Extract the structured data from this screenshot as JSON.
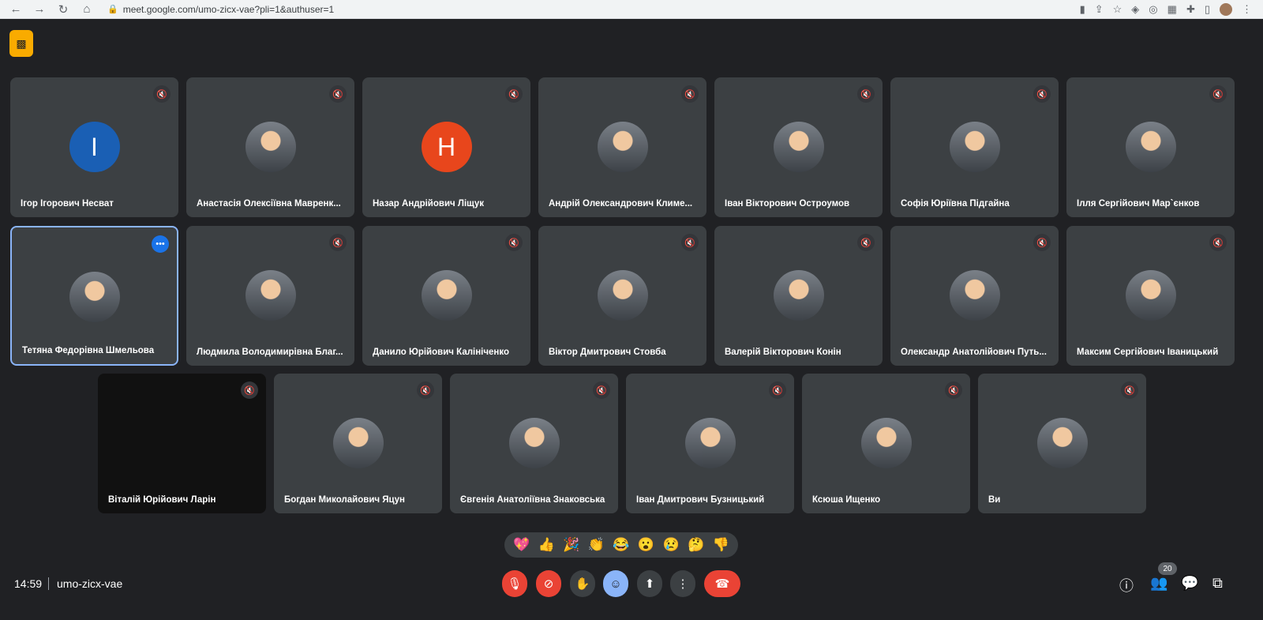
{
  "browser": {
    "url": "meet.google.com/umo-zicx-vae?pli=1&authuser=1",
    "nav_icons": [
      "back-icon",
      "forward-icon",
      "reload-icon",
      "home-icon"
    ]
  },
  "tiles": [
    {
      "name": "Ігор Ігорович Несват",
      "letter": "І",
      "color": "#1a5fb4"
    },
    {
      "name": "Анастасія Олексіївна Мавренк..."
    },
    {
      "name": "Назар Андрійович Ліщук",
      "letter": "Н",
      "color": "#e8461c"
    },
    {
      "name": "Андрій Олександрович Климе..."
    },
    {
      "name": "Іван Вікторович Остроумов"
    },
    {
      "name": "Софія Юріївна Підгайна"
    },
    {
      "name": "Ілля Сергійович Мар`єнков"
    },
    {
      "name": "Тетяна Федорівна Шмельова",
      "selected": true
    },
    {
      "name": "Людмила Володимирівна Благ..."
    },
    {
      "name": "Данило Юрійович Калініченко"
    },
    {
      "name": "Віктор Дмитрович Стовба"
    },
    {
      "name": "Валерій Вікторович Конін"
    },
    {
      "name": "Олександр Анатолійович Путь..."
    },
    {
      "name": "Максим Сергійович Іваницький"
    },
    {
      "name": "Віталій Юрійович Ларін",
      "dark": true
    },
    {
      "name": "Богдан Миколайович Яцун"
    },
    {
      "name": "Євгенія Анатоліївна Знаковська"
    },
    {
      "name": "Іван Дмитрович Бузницький"
    },
    {
      "name": "Ксюша Ищенко"
    },
    {
      "name": "Ви"
    }
  ],
  "reactions": [
    "💖",
    "👍",
    "🎉",
    "👏",
    "😂",
    "😮",
    "😢",
    "🤔",
    "👎"
  ],
  "footer": {
    "time": "14:59",
    "meeting_code": "umo-zicx-vae",
    "participant_count": "20"
  },
  "colors": {
    "background": "#202124",
    "tile": "#3c4043",
    "red": "#ea4335",
    "accent": "#8ab4f8"
  }
}
